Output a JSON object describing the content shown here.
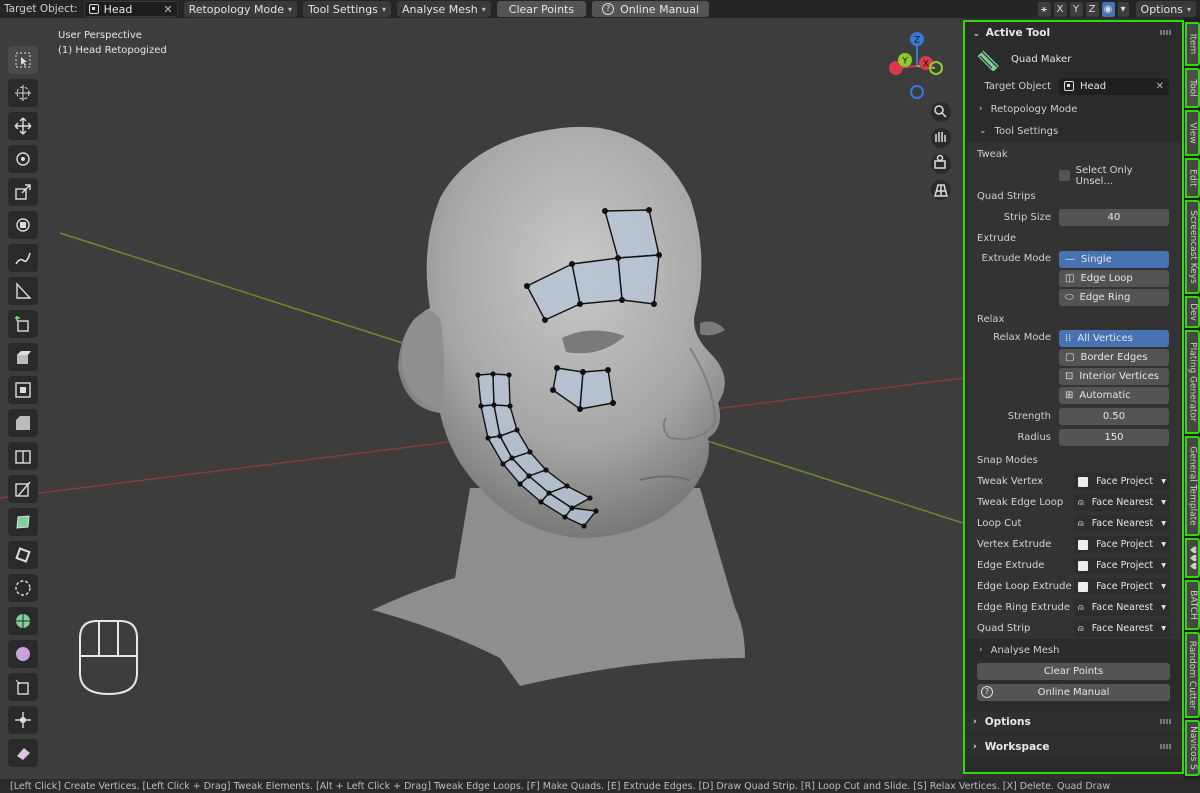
{
  "topbar": {
    "target_label": "Target Object:",
    "target_value": "Head",
    "retopology_mode": "Retopology Mode",
    "tool_settings": "Tool Settings",
    "analyse_mesh": "Analyse Mesh",
    "clear_points": "Clear Points",
    "online_manual": "Online Manual",
    "axes": [
      "X",
      "Y",
      "Z"
    ],
    "options": "Options"
  },
  "viewport": {
    "perspective": "User Perspective",
    "object": "(1) Head Retopogized"
  },
  "panel": {
    "active_tool": "Active Tool",
    "tool_name": "Quad Maker",
    "target_object_label": "Target Object",
    "target_object_value": "Head",
    "retopology_mode": "Retopology Mode",
    "tool_settings": "Tool Settings",
    "tweak": "Tweak",
    "select_only": "Select Only Unsel...",
    "quad_strips": "Quad Strips",
    "strip_size_label": "Strip Size",
    "strip_size": "40",
    "extrude": "Extrude",
    "extrude_mode_label": "Extrude Mode",
    "extrude_modes": [
      "Single",
      "Edge Loop",
      "Edge Ring"
    ],
    "relax": "Relax",
    "relax_mode_label": "Relax Mode",
    "relax_modes": [
      "All Vertices",
      "Border Edges",
      "Interior Vertices",
      "Automatic"
    ],
    "strength_label": "Strength",
    "strength": "0.50",
    "radius_label": "Radius",
    "radius": "150",
    "snap_modes": "Snap Modes",
    "snaps": [
      {
        "label": "Tweak Vertex",
        "value": "Face Project"
      },
      {
        "label": "Tweak Edge Loop",
        "value": "Face Nearest"
      },
      {
        "label": "Loop Cut",
        "value": "Face Nearest"
      },
      {
        "label": "Vertex Extrude",
        "value": "Face Project"
      },
      {
        "label": "Edge Extrude",
        "value": "Face Project"
      },
      {
        "label": "Edge Loop Extrude",
        "value": "Face Project"
      },
      {
        "label": "Edge Ring Extrude",
        "value": "Face Nearest"
      },
      {
        "label": "Quad Strip",
        "value": "Face Nearest"
      }
    ],
    "analyse_mesh": "Analyse Mesh",
    "clear_points": "Clear Points",
    "online_manual": "Online Manual",
    "options": "Options",
    "workspace": "Workspace"
  },
  "tabs": [
    "Item",
    "Tool",
    "View",
    "Edit",
    "Screencast Keys",
    "Dev",
    "Plating Generator",
    "General Template",
    "♥♥♥",
    "BATCH",
    "Random Cutter",
    "Navicos S"
  ],
  "statusbar": "[Left Click] Create Vertices.   [Left Click + Drag] Tweak Elements.   [Alt + Left Click + Drag] Tweak Edge Loops.   [F] Make Quads.   [E] Extrude Edges.   [D] Draw Quad Strip.   [R] Loop Cut and Slide.   [S] Relax Vertices.   [X] Delete.   Quad Draw",
  "colors": {
    "accent": "#4772b3",
    "highlight": "#33d60f"
  }
}
